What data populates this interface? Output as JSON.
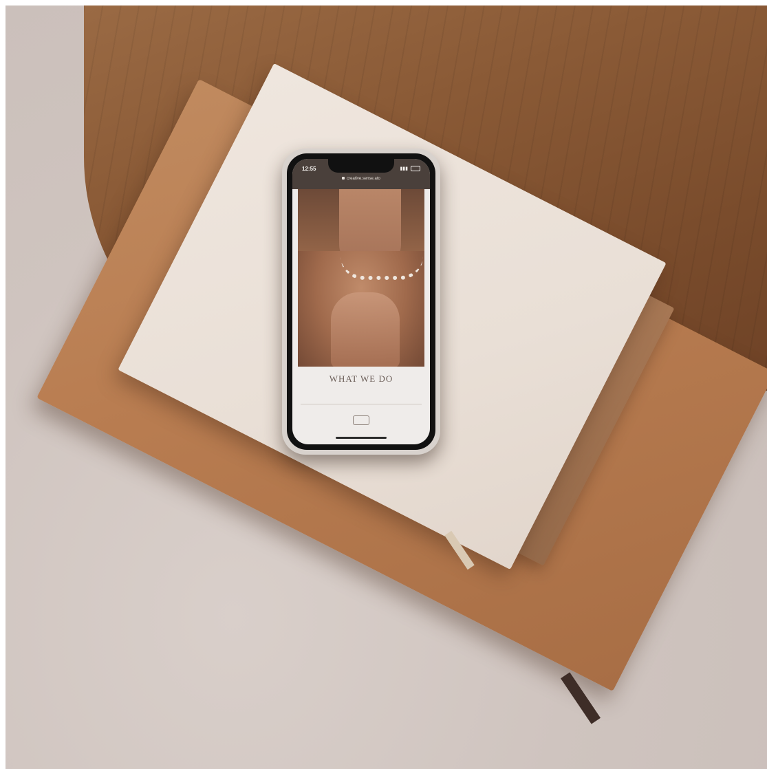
{
  "colors": {
    "table": "#8a5a36",
    "leather": "#b97d51",
    "book_white": "#e9dfd6",
    "phone_case": "#d8d2cd"
  },
  "phone": {
    "status_time": "12:55",
    "url": "creative.sense.ato",
    "headline": "WHAT WE DO"
  }
}
